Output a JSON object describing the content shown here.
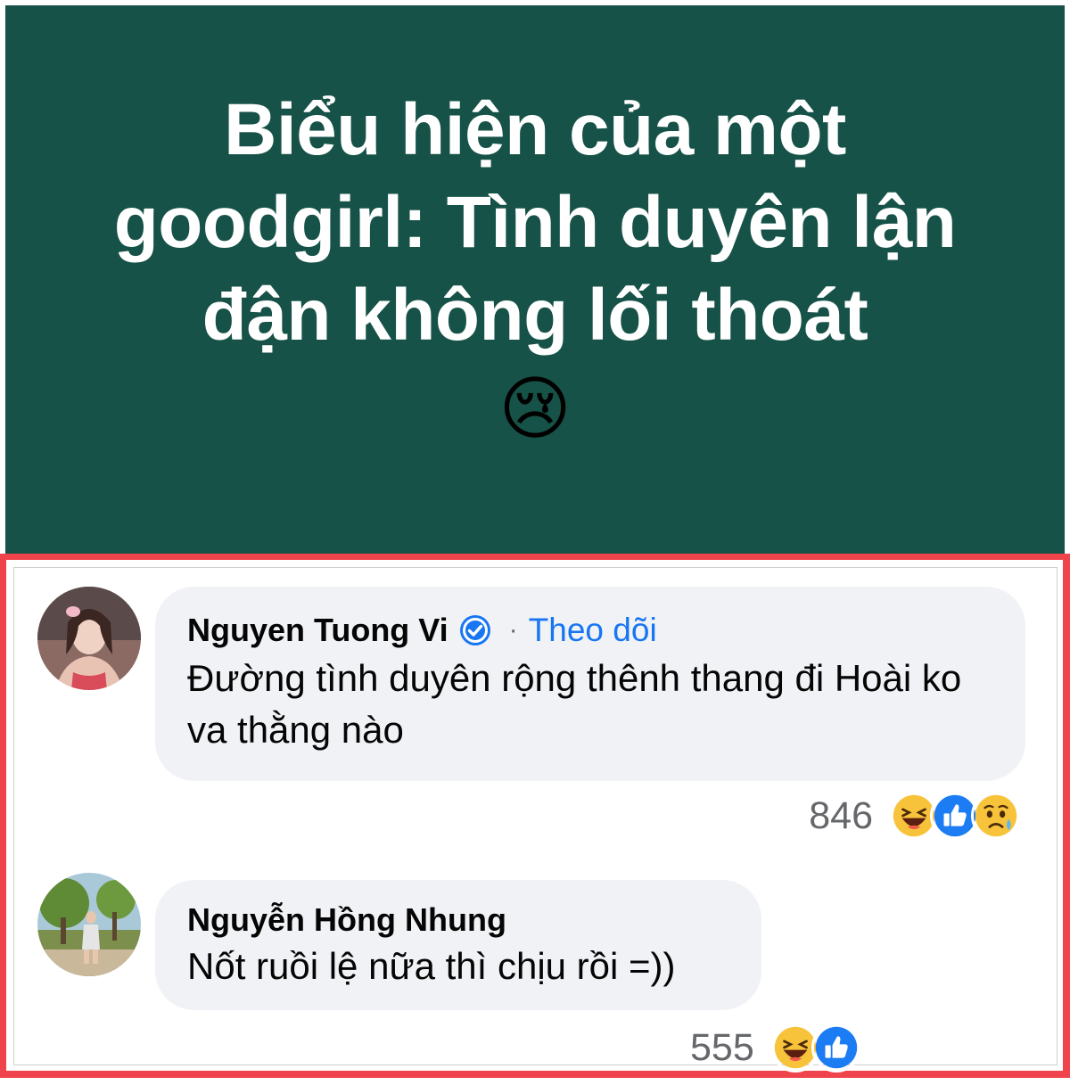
{
  "post": {
    "title": "Biểu hiện của một goodgirl: Tình duyên lận đận không lối thoát",
    "emoji": "😢",
    "background_color": "#165247"
  },
  "comments": [
    {
      "author": "Nguyen Tuong Vi",
      "verified": true,
      "separator": "·",
      "follow_label": "Theo dõi",
      "text": "Đường tình duyên rộng thênh thang đi Hoài ko va thằng nào",
      "reaction_count": "846",
      "reactions": [
        "haha-icon",
        "like-icon",
        "sad-icon"
      ]
    },
    {
      "author": "Nguyễn Hồng Nhung",
      "verified": false,
      "text": "Nốt ruồi lệ nữa thì chịu rồi =))",
      "reaction_count": "555",
      "reactions": [
        "haha-icon",
        "like-icon"
      ]
    }
  ],
  "colors": {
    "highlight_border": "#f0444d",
    "link": "#1876f2",
    "bubble": "#f0f2f5"
  }
}
